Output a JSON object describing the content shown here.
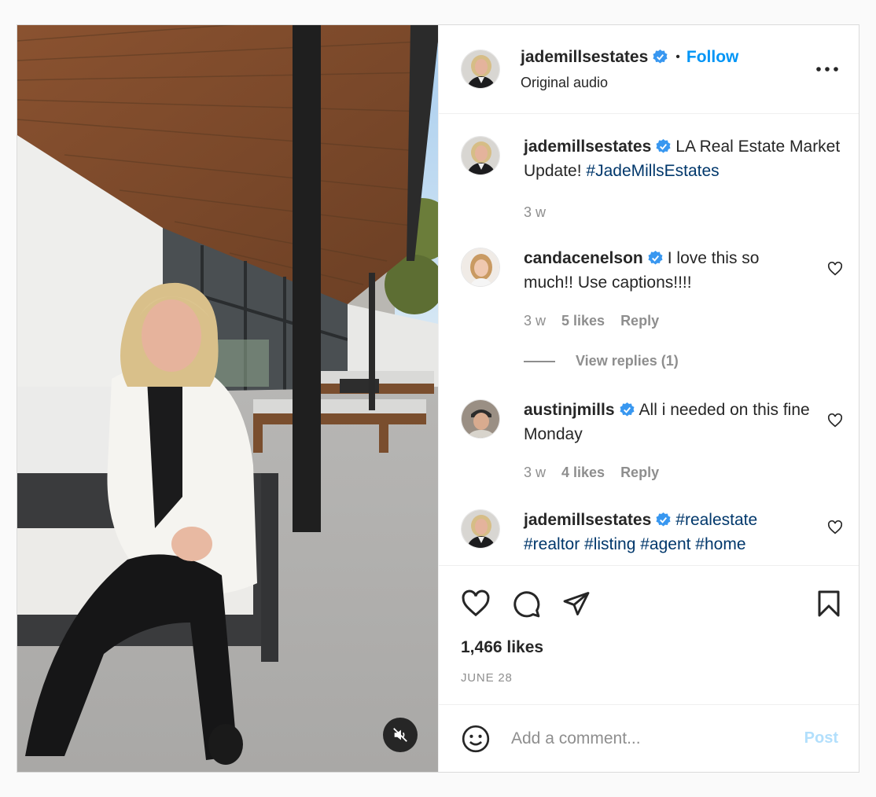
{
  "header": {
    "username": "jademillsestates",
    "separator": "•",
    "follow_label": "Follow",
    "subtitle": "Original audio",
    "more_icon": "more-horizontal-icon"
  },
  "comments": [
    {
      "username": "jademillsestates",
      "text": "LA Real Estate Market Update!",
      "hashtags": "#JadeMillsEstates",
      "time": "3 w"
    },
    {
      "username": "candacenelson",
      "text": "I love this so much!! Use captions!!!!",
      "time": "3 w",
      "likes": "5 likes",
      "reply_label": "Reply",
      "view_replies": "View replies (1)"
    },
    {
      "username": "austinjmills",
      "text": "All i needed on this fine Monday",
      "time": "3 w",
      "likes": "4 likes",
      "reply_label": "Reply"
    },
    {
      "username": "jademillsestates",
      "hashtags": "#realestate #realtor #listing #agent #home"
    }
  ],
  "actions": {
    "icons": [
      "heart-icon",
      "comment-icon",
      "share-icon",
      "bookmark-icon"
    ],
    "likes": "1,466 likes",
    "date": "JUNE 28"
  },
  "add_comment": {
    "placeholder": "Add a comment...",
    "post_label": "Post"
  },
  "colors": {
    "link_blue": "#0095f6",
    "hashtag": "#00376b",
    "post_disabled": "#b2dffc",
    "muted_text": "#8e8e8e",
    "verified_badge": "#3897f0"
  }
}
